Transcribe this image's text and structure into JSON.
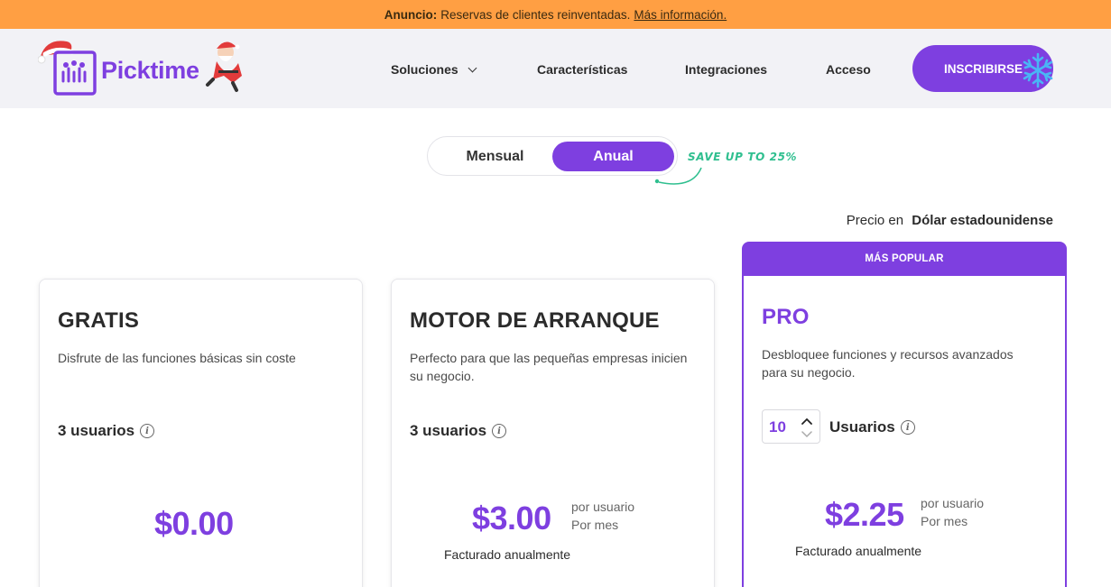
{
  "announcement": {
    "label": "Anuncio:",
    "text": "Reservas de clientes reinventadas.",
    "link": "Más información."
  },
  "header": {
    "brand": "Picktime",
    "nav": [
      {
        "label": "Soluciones",
        "has_dropdown": true
      },
      {
        "label": "Características"
      },
      {
        "label": "Integraciones"
      },
      {
        "label": "Acceso"
      }
    ],
    "cta": "INSCRIBIRSE"
  },
  "billing_toggle": {
    "monthly": "Mensual",
    "annual": "Anual",
    "selected": "annual",
    "save_note": "SAVE UP TO 25%"
  },
  "currency": {
    "label": "Precio en",
    "value": "Dólar estadounidense"
  },
  "plans": [
    {
      "name": "GRATIS",
      "description": "Disfrute de las funciones básicas sin coste",
      "users": "3 usuarios",
      "price": "$0.00"
    },
    {
      "name": "MOTOR DE ARRANQUE",
      "description": "Perfecto para que las pequeñas empresas inicien su negocio.",
      "users": "3 usuarios",
      "price": "$3.00",
      "per_user": "por usuario",
      "per_month": "Por mes",
      "billed": "Facturado anualmente"
    },
    {
      "badge": "MÁS POPULAR",
      "name": "PRO",
      "description": "Desbloquee funciones y recursos avanzados para su negocio.",
      "users_count": "10",
      "users_label": "Usuarios",
      "price": "$2.25",
      "per_user": "por usuario",
      "per_month": "Por mes",
      "billed": "Facturado anualmente"
    }
  ],
  "colors": {
    "brand_purple": "#7e3fe0",
    "announce_bg": "#ff9f43",
    "header_bg": "#f2f2f6",
    "save_green": "#2fbf8f"
  }
}
